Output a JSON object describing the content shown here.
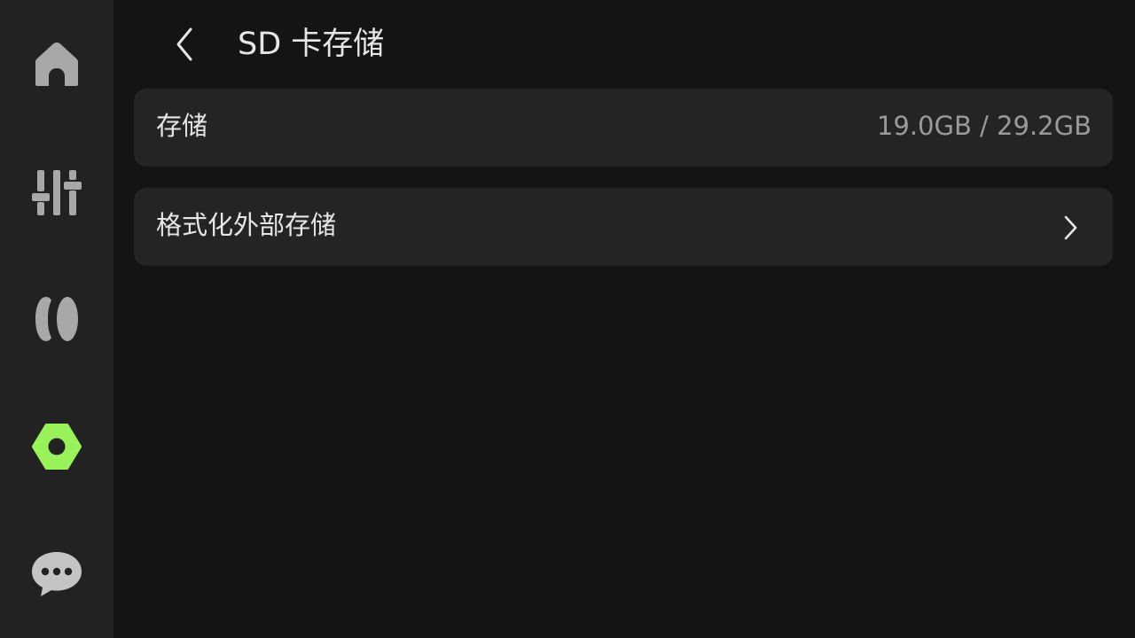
{
  "sidebar": {
    "items": [
      {
        "name": "home",
        "icon": "home-icon",
        "active": false
      },
      {
        "name": "adjust",
        "icon": "sliders-icon",
        "active": false
      },
      {
        "name": "lens",
        "icon": "lens-icon",
        "active": false
      },
      {
        "name": "settings",
        "icon": "settings-icon",
        "active": true
      },
      {
        "name": "messages",
        "icon": "chat-bubble-icon",
        "active": false
      }
    ]
  },
  "header": {
    "title": "SD 卡存储"
  },
  "storage": {
    "label": "存储",
    "value": "19.0GB / 29.2GB"
  },
  "format": {
    "label": "格式化外部存储"
  },
  "colors": {
    "background": "#141414",
    "sidebar": "#222222",
    "card": "#242424",
    "icon": "#a8a8a8",
    "accent": "#99f25a",
    "text": "#e6e6e6",
    "muted_text": "#9a9a9a"
  }
}
